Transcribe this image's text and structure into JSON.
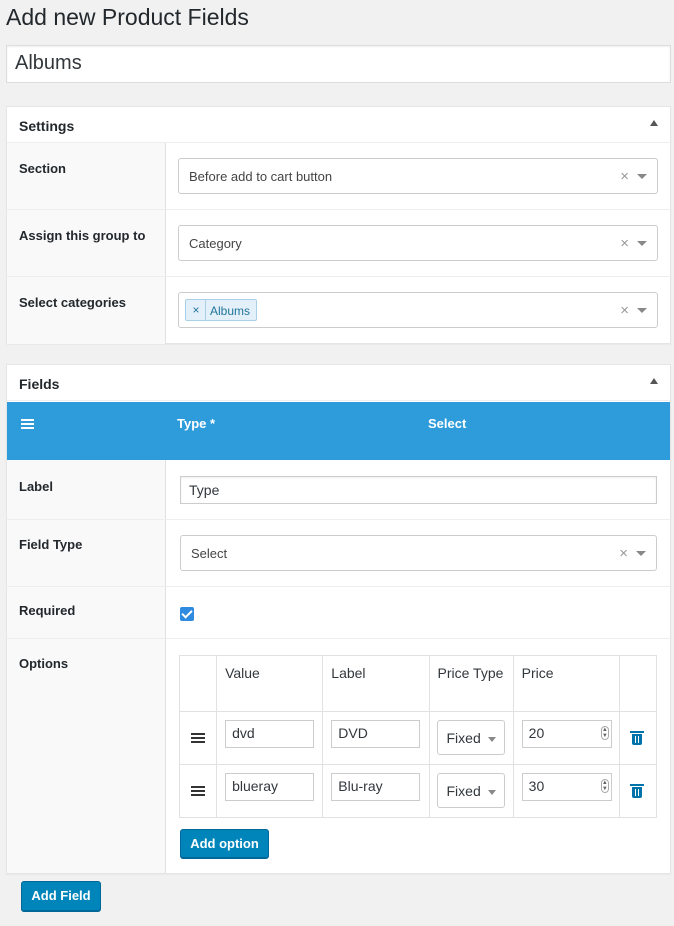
{
  "page": {
    "title": "Add new Product Fields"
  },
  "group_title": {
    "value": "Albums"
  },
  "settings": {
    "title": "Settings",
    "section": {
      "label": "Section",
      "value": "Before add to cart button",
      "clear": "×"
    },
    "assign": {
      "label": "Assign this group to",
      "value": "Category",
      "clear": "×"
    },
    "categories": {
      "label": "Select categories",
      "tags": [
        "Albums"
      ],
      "tag_remove": "×",
      "clear": "×"
    }
  },
  "fields": {
    "title": "Fields",
    "field_header": {
      "name": "Type *",
      "type": "Select"
    },
    "label": {
      "label": "Label",
      "value": "Type"
    },
    "field_type": {
      "label": "Field Type",
      "value": "Select",
      "clear": "×"
    },
    "required": {
      "label": "Required",
      "checked": true
    },
    "options": {
      "label": "Options",
      "columns": [
        "Value",
        "Label",
        "Price Type",
        "Price"
      ],
      "rows": [
        {
          "value": "dvd",
          "label": "DVD",
          "price_type": "Fixed",
          "price": "20"
        },
        {
          "value": "blueray",
          "label": "Blu-ray",
          "price_type": "Fixed",
          "price": "30"
        }
      ],
      "add_option": "Add option"
    }
  },
  "add_field": "Add Field",
  "colors": {
    "accent": "#2e9cdb",
    "button": "#0085ba"
  }
}
